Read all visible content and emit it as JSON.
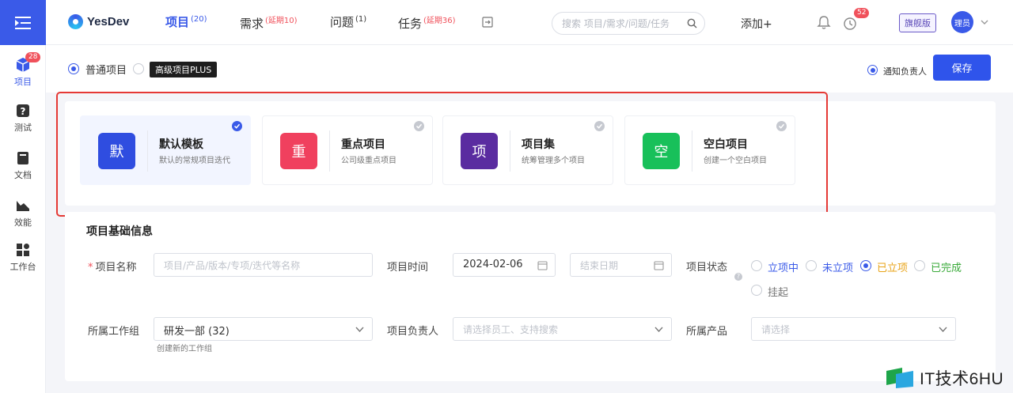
{
  "rail": {
    "items": [
      {
        "label": "项目",
        "badge": "28"
      },
      {
        "label": "测试"
      },
      {
        "label": "文档"
      },
      {
        "label": "效能"
      },
      {
        "label": "工作台"
      }
    ]
  },
  "header": {
    "logo_text": "YesDev",
    "nav": [
      {
        "label": "项目",
        "sup": "(20)"
      },
      {
        "label": "需求",
        "sup": "(延期10)"
      },
      {
        "label": "问题",
        "sup": "(1)"
      },
      {
        "label": "任务",
        "sup": "(延期36)"
      }
    ],
    "search_placeholder": "搜索 项目/需求/问题/任务",
    "add_label": "添加+",
    "clock_badge": "52",
    "edition_label": "旗舰版",
    "avatar_text": "理员"
  },
  "options": {
    "normal_label": "普通项目",
    "plus_label": "高级项目PLUS",
    "notify_label": "通知负责人",
    "save_label": "保存"
  },
  "templates": [
    {
      "glyph": "默",
      "title": "默认模板",
      "desc": "默认的常规项目迭代",
      "color": "#2f4de0",
      "selected": true
    },
    {
      "glyph": "重",
      "title": "重点项目",
      "desc": "公司级重点项目",
      "color": "#f0405e",
      "selected": false
    },
    {
      "glyph": "项",
      "title": "项目集",
      "desc": "统筹管理多个项目",
      "color": "#5a2ca0",
      "selected": false
    },
    {
      "glyph": "空",
      "title": "空白项目",
      "desc": "创建一个空白项目",
      "color": "#18c05a",
      "selected": false
    }
  ],
  "form": {
    "section_title": "项目基础信息",
    "name_label": "项目名称",
    "name_placeholder": "项目/产品/版本/专项/迭代等名称",
    "time_label": "项目时间",
    "start_date": "2024-02-06",
    "end_placeholder": "结束日期",
    "status_label": "项目状态",
    "statuses": [
      {
        "label": "立项中",
        "color": "#3a5ae8",
        "checked": false
      },
      {
        "label": "未立项",
        "color": "#3a5ae8",
        "checked": false
      },
      {
        "label": "已立项",
        "color": "#e8a317",
        "checked": true
      },
      {
        "label": "已完成",
        "color": "#3aaa3a",
        "checked": false
      },
      {
        "label": "挂起",
        "color": "#777777",
        "checked": false
      }
    ],
    "group_label": "所属工作组",
    "group_value": "研发一部 (32)",
    "group_hint": "创建新的工作组",
    "owner_label": "项目负责人",
    "owner_placeholder": "请选择员工、支持搜索",
    "product_label": "所属产品",
    "product_placeholder": "请选择"
  },
  "watermark": "IT技术6HU"
}
